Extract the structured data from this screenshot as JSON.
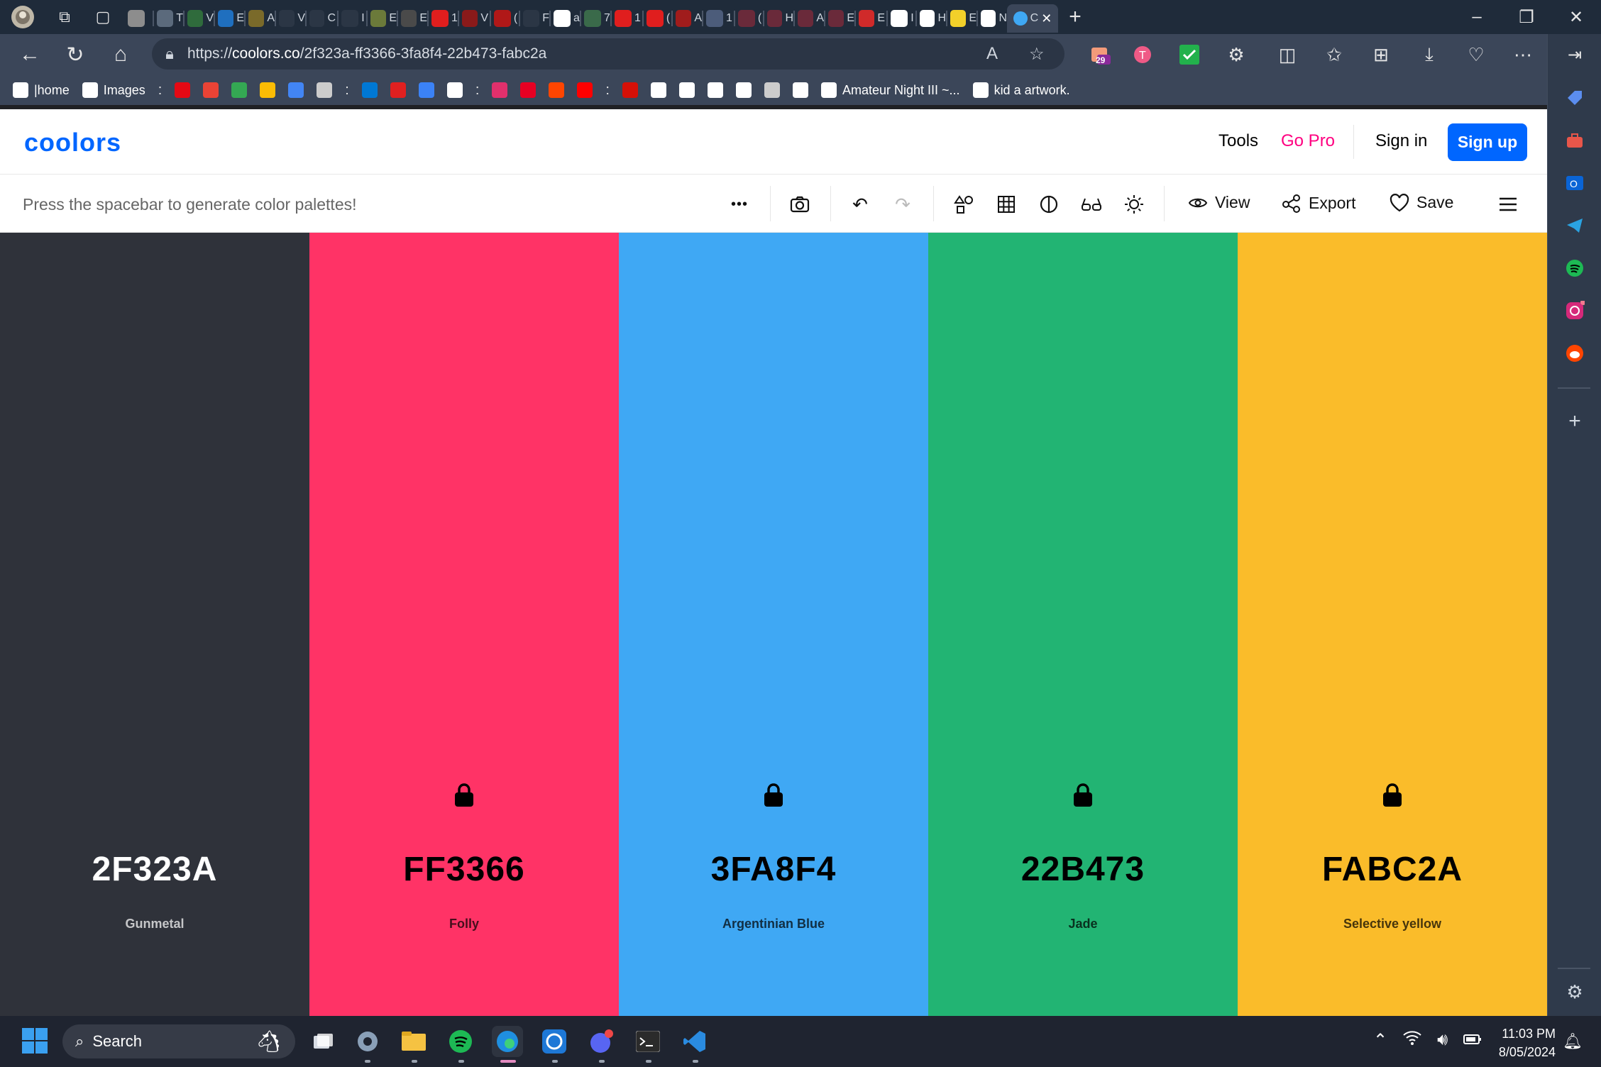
{
  "browser": {
    "tabs": [
      {
        "color": "#8d8d8d",
        "label": ""
      },
      {
        "color": "#5b6a7c",
        "label": "T"
      },
      {
        "color": "#2f6b3c",
        "label": "V"
      },
      {
        "color": "#1f6fbf",
        "label": "E"
      },
      {
        "color": "#7a6a2a",
        "label": "A"
      },
      {
        "color": "#2b3645",
        "label": "V"
      },
      {
        "color": "#2b3645",
        "label": "C"
      },
      {
        "color": "#2b3645",
        "label": "I"
      },
      {
        "color": "#6b7a3a",
        "label": "E"
      },
      {
        "color": "#4a4a4a",
        "label": "E"
      },
      {
        "color": "#e01e1e",
        "label": "1"
      },
      {
        "color": "#8a1a1a",
        "label": "V"
      },
      {
        "color": "#b01818",
        "label": "("
      },
      {
        "color": "#2b3645",
        "label": "F"
      },
      {
        "color": "#ffffff",
        "label": "a"
      },
      {
        "color": "#3a6a4a",
        "label": "7"
      },
      {
        "color": "#e01e1e",
        "label": "1"
      },
      {
        "color": "#e01e1e",
        "label": "("
      },
      {
        "color": "#a01c1c",
        "label": "A"
      },
      {
        "color": "#4c5c7a",
        "label": "1"
      },
      {
        "color": "#6a2a3a",
        "label": "("
      },
      {
        "color": "#6a2a3a",
        "label": "H"
      },
      {
        "color": "#6a2a3a",
        "label": "A"
      },
      {
        "color": "#6a2a3a",
        "label": "E"
      },
      {
        "color": "#d02a2a",
        "label": "E"
      },
      {
        "color": "#ffffff",
        "label": "I"
      },
      {
        "color": "#ffffff",
        "label": "H"
      },
      {
        "color": "#f2d02a",
        "label": "E"
      },
      {
        "color": "#ffffff",
        "label": "N"
      }
    ],
    "active_tab_label": "C",
    "new_tab": "+",
    "url_prefix": "https://",
    "url_domain": "coolors.co",
    "url_path": "/2f323a-ff3366-3fa8f4-22b473-fabc2a",
    "ext_badge_count": "29",
    "bookmarks": [
      {
        "label": "|home",
        "icon": "notion-icon",
        "color": "#ffffff"
      },
      {
        "label": "Images",
        "icon": "google-icon",
        "color": "#ffffff"
      },
      {
        "label": "",
        "icon": "netflix-icon",
        "color": "#e50914"
      },
      {
        "label": "",
        "icon": "gmail-icon",
        "color": "#ea4335"
      },
      {
        "label": "",
        "icon": "drive-icon",
        "color": "#34a853"
      },
      {
        "label": "",
        "icon": "maps-icon",
        "color": "#fbbc05"
      },
      {
        "label": "",
        "icon": "translate-icon",
        "color": "#4285f4"
      },
      {
        "label": "",
        "icon": "raccoon-icon",
        "color": "#cccccc"
      },
      {
        "label": "",
        "icon": "outlook-icon",
        "color": "#0078d4"
      },
      {
        "label": "",
        "icon": "red-dot-icon",
        "color": "#e02020"
      },
      {
        "label": "",
        "icon": "pen-icon",
        "color": "#3b82f6"
      },
      {
        "label": "",
        "icon": "github-icon",
        "color": "#ffffff"
      },
      {
        "label": "",
        "icon": "instagram-icon",
        "color": "#e1306c"
      },
      {
        "label": "",
        "icon": "pinterest-icon",
        "color": "#e60023"
      },
      {
        "label": "",
        "icon": "reddit-icon",
        "color": "#ff4500"
      },
      {
        "label": "",
        "icon": "youtube-icon",
        "color": "#ff0000"
      },
      {
        "label": "",
        "icon": "lastfm-icon",
        "color": "#d51007"
      },
      {
        "label": "",
        "icon": "music-icon",
        "color": "#ffffff"
      },
      {
        "label": "",
        "icon": "headphones-icon",
        "color": "#ffffff"
      },
      {
        "label": "",
        "icon": "lastfm-text-icon",
        "color": "#ffffff"
      },
      {
        "label": "",
        "icon": "letter-a-icon",
        "color": "#ffffff"
      },
      {
        "label": "",
        "icon": "card-icon",
        "color": "#cccccc"
      },
      {
        "label": "",
        "icon": "circle-arrow-icon",
        "color": "#ffffff"
      },
      {
        "label": "Amateur Night III ~...",
        "icon": "mascot-icon",
        "color": "#ffffff"
      },
      {
        "label": "kid a artwork.",
        "icon": "page-icon",
        "color": "#ffffff"
      }
    ],
    "bookmark_dots": ":"
  },
  "coolors": {
    "logo": "coolors",
    "nav": {
      "tools": "Tools",
      "go_pro": "Go Pro",
      "sign_in": "Sign in",
      "sign_up": "Sign up"
    },
    "toolbar": {
      "hint": "Press the spacebar to generate color palettes!",
      "more": "•••",
      "view": "View",
      "export": "Export",
      "save": "Save"
    },
    "palette": [
      {
        "hex": "2F323A",
        "name": "Gunmetal",
        "bg": "#2f323a",
        "fg": "#ffffff",
        "locked": false
      },
      {
        "hex": "FF3366",
        "name": "Folly",
        "bg": "#ff3366",
        "fg": "#000000",
        "locked": true
      },
      {
        "hex": "3FA8F4",
        "name": "Argentinian Blue",
        "bg": "#3fa8f4",
        "fg": "#000000",
        "locked": true
      },
      {
        "hex": "22B473",
        "name": "Jade",
        "bg": "#22b473",
        "fg": "#000000",
        "locked": true
      },
      {
        "hex": "FABC2A",
        "name": "Selective yellow",
        "bg": "#fabc2a",
        "fg": "#000000",
        "locked": true
      }
    ]
  },
  "taskbar": {
    "search": "Search",
    "time": "11:03 PM",
    "date": "8/05/2024"
  }
}
